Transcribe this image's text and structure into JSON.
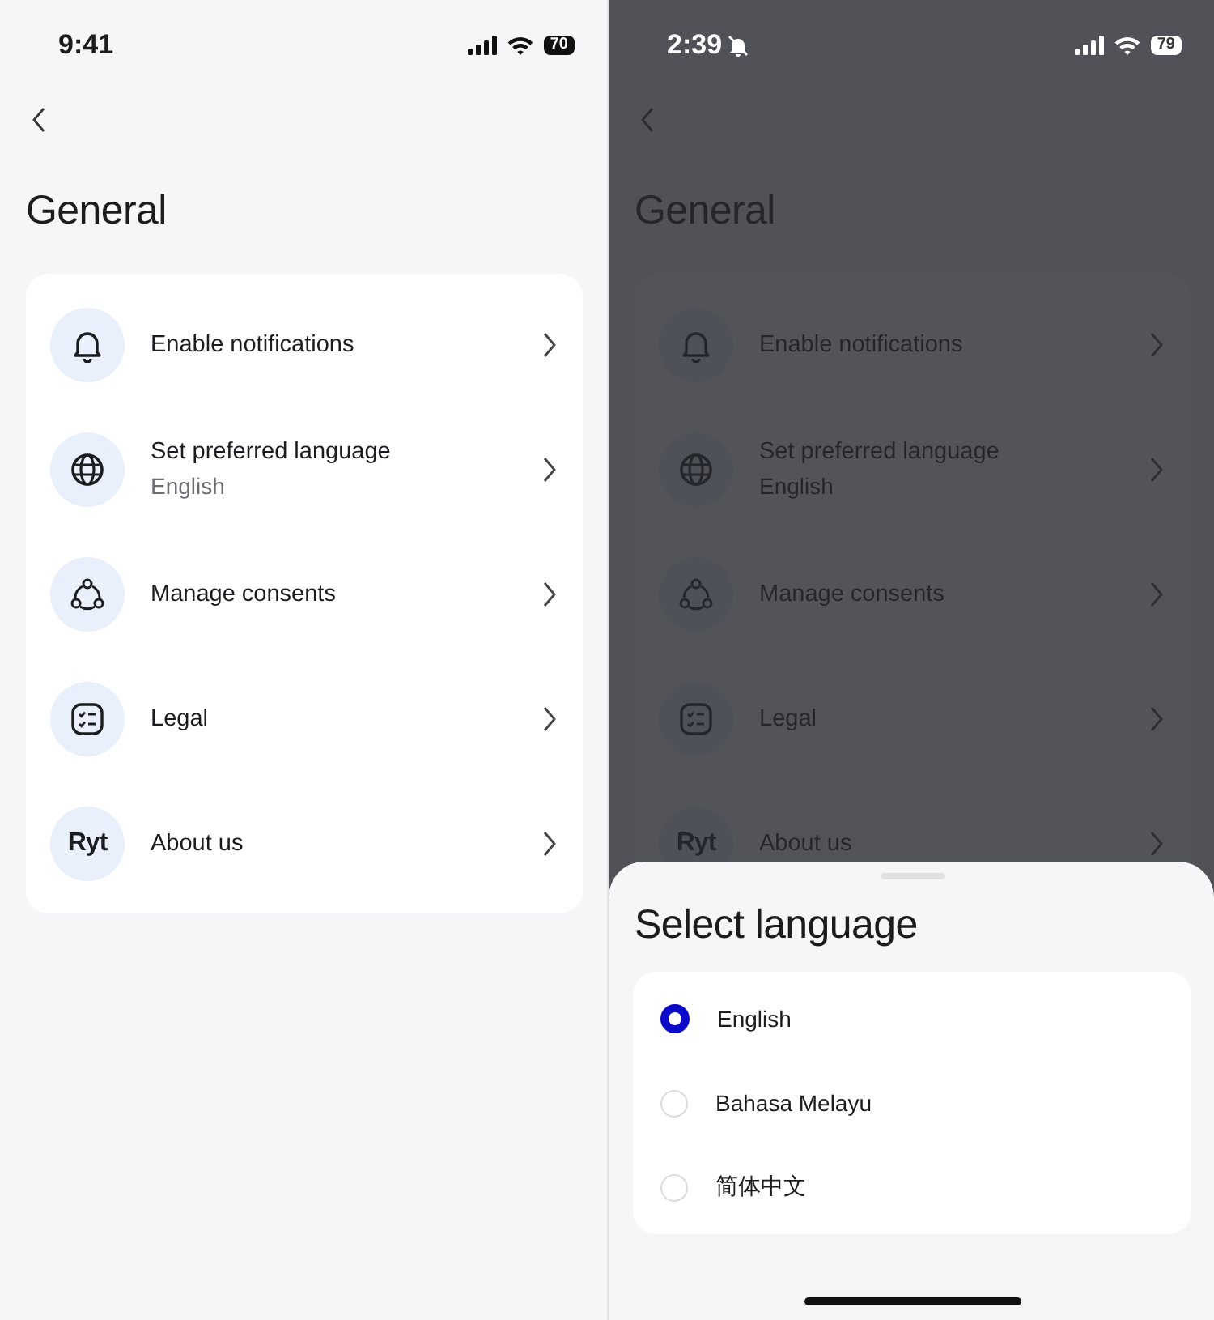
{
  "screens": [
    {
      "status_bar": {
        "time": "9:41",
        "battery": "70"
      },
      "title": "General",
      "dimmed": false,
      "menu": [
        {
          "kind": "bell",
          "label": "Enable notifications"
        },
        {
          "kind": "globe",
          "label": "Set preferred language",
          "value": "English"
        },
        {
          "kind": "consent",
          "label": "Manage consents"
        },
        {
          "kind": "checklist",
          "label": "Legal"
        },
        {
          "kind": "logo",
          "logo_text": "Ryt",
          "label": "About us"
        }
      ]
    },
    {
      "status_bar": {
        "time": "2:39",
        "silent": true,
        "battery": "79"
      },
      "title": "General",
      "dimmed": true,
      "menu": [
        {
          "kind": "bell",
          "label": "Enable notifications"
        },
        {
          "kind": "globe",
          "label": "Set preferred language",
          "value": "English"
        },
        {
          "kind": "consent",
          "label": "Manage consents"
        },
        {
          "kind": "checklist",
          "label": "Legal"
        },
        {
          "kind": "logo",
          "logo_text": "Ryt",
          "label": "About us"
        }
      ],
      "sheet": {
        "title": "Select language",
        "options": [
          {
            "label": "English",
            "selected": true
          },
          {
            "label": "Bahasa Melayu",
            "selected": false
          },
          {
            "label": "简体中文",
            "selected": false
          }
        ]
      }
    }
  ]
}
